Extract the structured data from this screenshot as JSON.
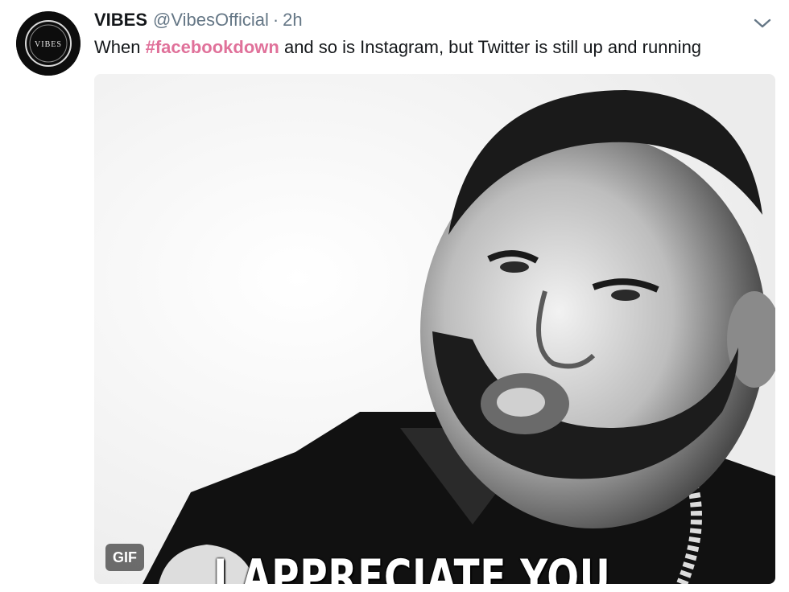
{
  "tweet": {
    "display_name": "VIBES",
    "handle": "@VibesOfficial",
    "separator": "·",
    "time": "2h",
    "text_before": "When ",
    "hashtag": "#facebookdown",
    "text_after": " and so is Instagram, but Twitter is still up and running",
    "avatar_text": "VIBES"
  },
  "media": {
    "caption": "I APPRECIATE YOU",
    "badge": "GIF"
  },
  "icons": {
    "menu": "chevron-down-icon"
  },
  "colors": {
    "hashtag": "#e0719a",
    "name": "#14171a",
    "secondary": "#657786"
  }
}
